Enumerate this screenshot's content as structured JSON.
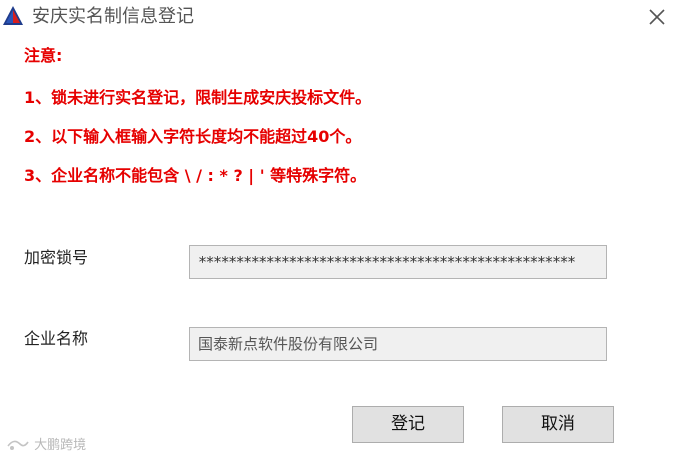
{
  "window": {
    "title": "安庆实名制信息登记"
  },
  "notice": {
    "heading": "注意:",
    "items": [
      "1、锁未进行实名登记，限制生成安庆投标文件。",
      "2、以下输入框输入字符长度均不能超过40个。",
      "3、企业名称不能包含 \\ / : * ? | ' 等特殊字符。"
    ],
    "color": "#e60000"
  },
  "form": {
    "lock_label": "加密锁号",
    "lock_value": "**************************************************",
    "company_label": "企业名称",
    "company_value": "国泰新点软件股份有限公司"
  },
  "buttons": {
    "register_label": "登记",
    "cancel_label": "取消"
  },
  "watermark": {
    "text": "大鹏跨境"
  },
  "icons": {
    "app": "triangle-logo-icon",
    "close": "close-icon"
  }
}
